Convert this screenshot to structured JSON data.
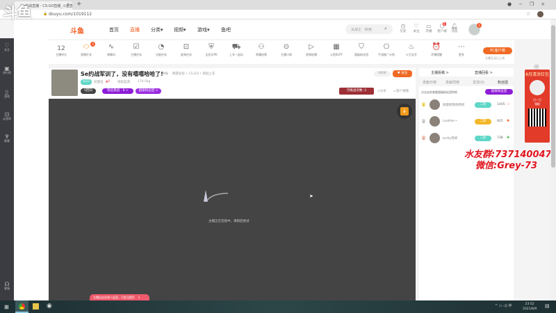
{
  "browser": {
    "tab_title": "Se约战直播 - CS:GO直播_斗鱼直播",
    "url": "douyu.com/1019112",
    "new_tab": "+",
    "watermark": "斗鱼"
  },
  "header": {
    "logo": "斗鱼",
    "nav": [
      "首页",
      "直播",
      "分类▾",
      "视频▾",
      "游戏▾",
      "鱼吧"
    ],
    "search_placeholder": "女战士 · 秋雨",
    "icons": [
      {
        "icon": "history-icon",
        "label": "历史"
      },
      {
        "icon": "follow-icon",
        "label": "关注"
      },
      {
        "icon": "live-icon",
        "label": "开播"
      },
      {
        "icon": "client-icon",
        "label": "客户端"
      },
      {
        "icon": "bell-icon",
        "label": "消息"
      }
    ],
    "client_badge": "8",
    "avatar_badge": "1"
  },
  "sidebar": {
    "items": [
      "关注",
      "排行榜",
      "游戏",
      "云游戏",
      "赛事"
    ],
    "bottom": "客服"
  },
  "toolbar": {
    "score": "12",
    "items": [
      "主播积分",
      "直播开关",
      "弹幕风",
      "主播任务",
      "光能任务",
      "星海任务",
      "全民乐PK",
      "上车一起玩",
      "荣耀抢票",
      "主播口袋",
      "视频轮播",
      "斗鱼BUFF",
      "超级粉丝团",
      "手游推广计划",
      "火力全开",
      "开播提醒",
      "更多"
    ],
    "switch_badge": "3",
    "pc_button": "PC客户端",
    "pc_sub": "主播互动已上线"
  },
  "room": {
    "title": "Se约战军训了，没有嘻嘻哈哈了!",
    "report": "举报",
    "category": "网游竞技 • CS:GO • 帮助上车",
    "level": "LV21",
    "tags": [
      "贰壹伍",
      "0",
      "地狱蓝调",
      "174.5kg"
    ],
    "badges": [
      "V回归",
      "粉丝挑战 · 8 >",
      "超级粉丝团 >"
    ],
    "followers": "9006",
    "follow": "关注",
    "promo": "可挑战次数: 2",
    "share": "分享",
    "client": "客户端看"
  },
  "player": {
    "loading": "主播正在连接中，请稍后尝试",
    "toast": "主播出击在线人层混，可会当提升",
    "toast_close": "×"
  },
  "panel": {
    "tabs_top": [
      "主播投稿 >",
      "直播回看 >"
    ],
    "tabs": [
      "贡献日榜",
      "贡献周榜",
      "贵宾(0)",
      "粉丝团"
    ],
    "hint": "点击去你查看超级粉丝团特权",
    "super_btn": "超级粉丝团",
    "ranks": [
      {
        "name": "别取昵称找特权",
        "level": "二阶",
        "score": "1405",
        "trend": "—",
        "crown": "#e6b800"
      },
      {
        "name": "Leather~",
        "level": "二阶",
        "score": "925",
        "trend": "✱",
        "crown": "#aaa"
      },
      {
        "name": "turtly寺修",
        "level": "二阶",
        "score": "738",
        "trend": "✚",
        "crown": "#d9896b"
      }
    ]
  },
  "ad": {
    "title": "8月清凉红包",
    "sub": "日一日",
    "btn": "领取"
  },
  "promo_text": {
    "line1": "水友群:737140047",
    "line2": "微信:Grey-73"
  },
  "taskbar": {
    "time": "23:52",
    "date": "2021/8/9"
  }
}
